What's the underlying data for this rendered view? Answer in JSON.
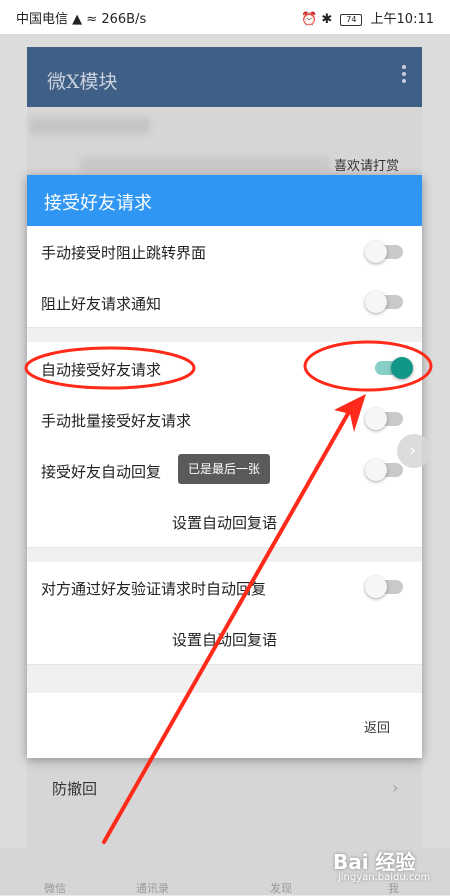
{
  "status_bar": {
    "carrier": "中国电信",
    "speed": "266B/s",
    "battery": "74",
    "time": "上午10:11"
  },
  "module_window": {
    "title": "微X模块",
    "donate_text": "喜欢请打赏",
    "bottom_item": "防撤回"
  },
  "bottom_nav": [
    "微信",
    "通讯录",
    "发现",
    "我"
  ],
  "dialog": {
    "title": "接受好友请求",
    "items": [
      {
        "label": "手动接受时阻止跳转界面",
        "on": false
      },
      {
        "label": "阻止好友请求通知",
        "on": false
      },
      {
        "label": "自动接受好友请求",
        "on": true
      },
      {
        "label": "手动批量接受好友请求",
        "on": false
      },
      {
        "label": "接受好友自动回复",
        "on": false
      },
      {
        "label": "对方通过好友验证请求时自动回复",
        "on": false
      }
    ],
    "set_reply_1": "设置自动回复语",
    "set_reply_2": "设置自动回复语",
    "back_label": "返回"
  },
  "toast": "已是最后一张",
  "watermark": {
    "brand": "Bai 经验",
    "url": "jingyan.baidu.com"
  },
  "colors": {
    "header": "#2f96f3",
    "switch_on": "#129688",
    "annotation": "#ff2a1a"
  }
}
